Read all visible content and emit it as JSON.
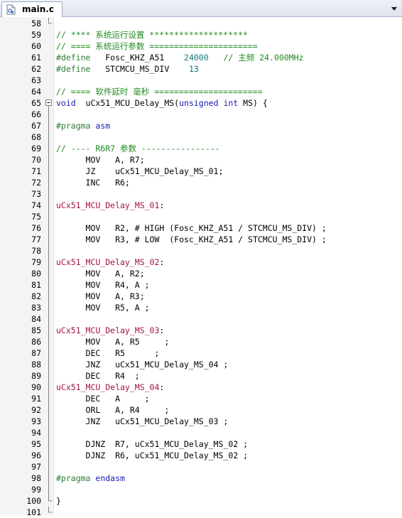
{
  "tab": {
    "filename": "main.c",
    "file_icon": "c-source-file-icon",
    "menu_icon": "dropdown-arrow-icon"
  },
  "colors": {
    "comment": "#228b22",
    "preprocessor": "#2e7d32",
    "keyword": "#1a1ab0",
    "label": "#a0144c",
    "number": "#0d7a7a",
    "text": "#000000",
    "gutter": "#f4f4f4"
  },
  "lines": [
    {
      "num": "58",
      "tokens": []
    },
    {
      "num": "59",
      "tokens": [
        {
          "t": "// **** 系统运行设置 ********************",
          "c": "comment"
        }
      ]
    },
    {
      "num": "60",
      "tokens": [
        {
          "t": "// ==== 系统运行参数 ======================",
          "c": "comment"
        }
      ]
    },
    {
      "num": "61",
      "tokens": [
        {
          "t": "#define",
          "c": "pre"
        },
        {
          "t": "   Fosc_KHZ_A51    ",
          "c": "plain"
        },
        {
          "t": "24000",
          "c": "num"
        },
        {
          "t": "   ",
          "c": "plain"
        },
        {
          "t": "// 主频 24.000MHz",
          "c": "comment"
        }
      ]
    },
    {
      "num": "62",
      "tokens": [
        {
          "t": "#define",
          "c": "pre"
        },
        {
          "t": "   STCMCU_MS_DIV    ",
          "c": "plain"
        },
        {
          "t": "13",
          "c": "num"
        }
      ]
    },
    {
      "num": "63",
      "tokens": []
    },
    {
      "num": "64",
      "tokens": [
        {
          "t": "// ==== 软件延时 毫秒 ======================",
          "c": "comment"
        }
      ]
    },
    {
      "num": "65",
      "fold": "open",
      "tokens": [
        {
          "t": "void",
          "c": "kw"
        },
        {
          "t": "  uCx51_MCU_Delay_MS(",
          "c": "plain"
        },
        {
          "t": "unsigned",
          "c": "kw"
        },
        {
          "t": " ",
          "c": "plain"
        },
        {
          "t": "int",
          "c": "kw"
        },
        {
          "t": " MS) {",
          "c": "plain"
        }
      ]
    },
    {
      "num": "66",
      "tokens": []
    },
    {
      "num": "67",
      "tokens": [
        {
          "t": "#pragma",
          "c": "pre"
        },
        {
          "t": " ",
          "c": "plain"
        },
        {
          "t": "asm",
          "c": "kw"
        }
      ]
    },
    {
      "num": "68",
      "tokens": []
    },
    {
      "num": "69",
      "tokens": [
        {
          "t": "// ---- R6R7 参数 ----------------",
          "c": "comment"
        }
      ]
    },
    {
      "num": "70",
      "tokens": [
        {
          "t": "      MOV   A, R7;",
          "c": "plain"
        }
      ]
    },
    {
      "num": "71",
      "tokens": [
        {
          "t": "      JZ    uCx51_MCU_Delay_MS_01;",
          "c": "plain"
        }
      ]
    },
    {
      "num": "72",
      "tokens": [
        {
          "t": "      INC   R6;",
          "c": "plain"
        }
      ]
    },
    {
      "num": "73",
      "tokens": []
    },
    {
      "num": "74",
      "tokens": [
        {
          "t": "uCx51_MCU_Delay_MS_01",
          "c": "label"
        },
        {
          "t": ":",
          "c": "plain"
        }
      ]
    },
    {
      "num": "75",
      "tokens": []
    },
    {
      "num": "76",
      "tokens": [
        {
          "t": "      MOV   R2, # HIGH (Fosc_KHZ_A51 / STCMCU_MS_DIV) ;",
          "c": "plain"
        }
      ]
    },
    {
      "num": "77",
      "tokens": [
        {
          "t": "      MOV   R3, # LOW  (Fosc_KHZ_A51 / STCMCU_MS_DIV) ;",
          "c": "plain"
        }
      ]
    },
    {
      "num": "78",
      "tokens": []
    },
    {
      "num": "79",
      "tokens": [
        {
          "t": "uCx51_MCU_Delay_MS_02",
          "c": "label"
        },
        {
          "t": ":",
          "c": "plain"
        }
      ]
    },
    {
      "num": "80",
      "tokens": [
        {
          "t": "      MOV   A, R2;",
          "c": "plain"
        }
      ]
    },
    {
      "num": "81",
      "tokens": [
        {
          "t": "      MOV   R4, A ;",
          "c": "plain"
        }
      ]
    },
    {
      "num": "82",
      "tokens": [
        {
          "t": "      MOV   A, R3;",
          "c": "plain"
        }
      ]
    },
    {
      "num": "83",
      "tokens": [
        {
          "t": "      MOV   R5, A ;",
          "c": "plain"
        }
      ]
    },
    {
      "num": "84",
      "tokens": []
    },
    {
      "num": "85",
      "tokens": [
        {
          "t": "uCx51_MCU_Delay_MS_03",
          "c": "label"
        },
        {
          "t": ":",
          "c": "plain"
        }
      ]
    },
    {
      "num": "86",
      "tokens": [
        {
          "t": "      MOV   A, R5     ;",
          "c": "plain"
        }
      ]
    },
    {
      "num": "87",
      "tokens": [
        {
          "t": "      DEC   R5      ;",
          "c": "plain"
        }
      ]
    },
    {
      "num": "88",
      "tokens": [
        {
          "t": "      JNZ   uCx51_MCU_Delay_MS_04 ;",
          "c": "plain"
        }
      ]
    },
    {
      "num": "89",
      "tokens": [
        {
          "t": "      DEC   R4  ;",
          "c": "plain"
        }
      ]
    },
    {
      "num": "90",
      "tokens": [
        {
          "t": "uCx51_MCU_Delay_MS_04",
          "c": "label"
        },
        {
          "t": ":",
          "c": "plain"
        }
      ]
    },
    {
      "num": "91",
      "tokens": [
        {
          "t": "      DEC   A     ;",
          "c": "plain"
        }
      ]
    },
    {
      "num": "92",
      "tokens": [
        {
          "t": "      ORL   A, R4     ;",
          "c": "plain"
        }
      ]
    },
    {
      "num": "93",
      "tokens": [
        {
          "t": "      JNZ   uCx51_MCU_Delay_MS_03 ;",
          "c": "plain"
        }
      ]
    },
    {
      "num": "94",
      "tokens": []
    },
    {
      "num": "95",
      "tokens": [
        {
          "t": "      DJNZ  R7, uCx51_MCU_Delay_MS_02 ;",
          "c": "plain"
        }
      ]
    },
    {
      "num": "96",
      "tokens": [
        {
          "t": "      DJNZ  R6, uCx51_MCU_Delay_MS_02 ;",
          "c": "plain"
        }
      ]
    },
    {
      "num": "97",
      "tokens": []
    },
    {
      "num": "98",
      "tokens": [
        {
          "t": "#pragma",
          "c": "pre"
        },
        {
          "t": " ",
          "c": "plain"
        },
        {
          "t": "endasm",
          "c": "kw"
        }
      ]
    },
    {
      "num": "99",
      "tokens": []
    },
    {
      "num": "100",
      "fold": "end",
      "tokens": [
        {
          "t": "}",
          "c": "plain"
        }
      ]
    },
    {
      "num": "101",
      "fold": "end",
      "tokens": []
    }
  ]
}
